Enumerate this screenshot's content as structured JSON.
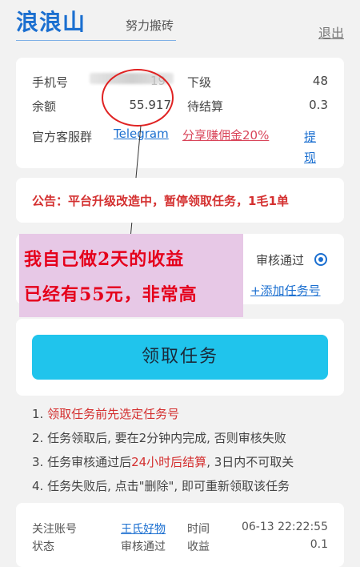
{
  "header": {
    "title": "浪浪山",
    "subtitle": "努力搬砖",
    "logout": "退出"
  },
  "info": {
    "phone_label": "手机号",
    "phone_partial": "19",
    "subordinate_label": "下级",
    "subordinate_value": "48",
    "balance_label": "余额",
    "balance_value": "55.917",
    "pending_label": "待结算",
    "pending_value": "0.3",
    "service_group_label": "官方客服群",
    "telegram_link": "Telegram",
    "share_link": "分享赚佣金20%",
    "withdraw_link": "提现"
  },
  "notice": {
    "text": "公告：平台升级改造中，暂停领取任务，1毛1单"
  },
  "task_select": {
    "review_passed": "审核通过",
    "add_task_account": "+添加任务号"
  },
  "promo": {
    "line1": "我自己做2天的收益",
    "line2": "已经有55元，非常高"
  },
  "action": {
    "claim_task": "领取任务"
  },
  "rules": [
    {
      "prefix": "1. ",
      "highlight": "领取任务前先选定任务号",
      "rest": ""
    },
    {
      "prefix": "2. 任务领取后, 要在2分钟内完成, 否则审核失败",
      "highlight": "",
      "rest": ""
    },
    {
      "prefix": "3. 任务审核通过后",
      "highlight": "24小时后结算",
      "rest": ", 3日内不可取关"
    },
    {
      "prefix": "4. 任务失败后, 点击\"删除\", 即可重新领取该任务",
      "highlight": "",
      "rest": ""
    }
  ],
  "record": {
    "follow_label": "关注账号",
    "follow_value": "王氏好物",
    "time_label": "时间",
    "time_value": "06-13 22:22:55",
    "status_label": "状态",
    "status_value": "审核通过",
    "income_label": "收益",
    "income_value": "0.1"
  },
  "colors": {
    "brand": "#1b6fd0",
    "button": "#20c4ec",
    "alert": "#d43030",
    "link_pink": "#d9455a",
    "promo_bg": "#e7c8e6",
    "promo_text": "#e5001b"
  }
}
